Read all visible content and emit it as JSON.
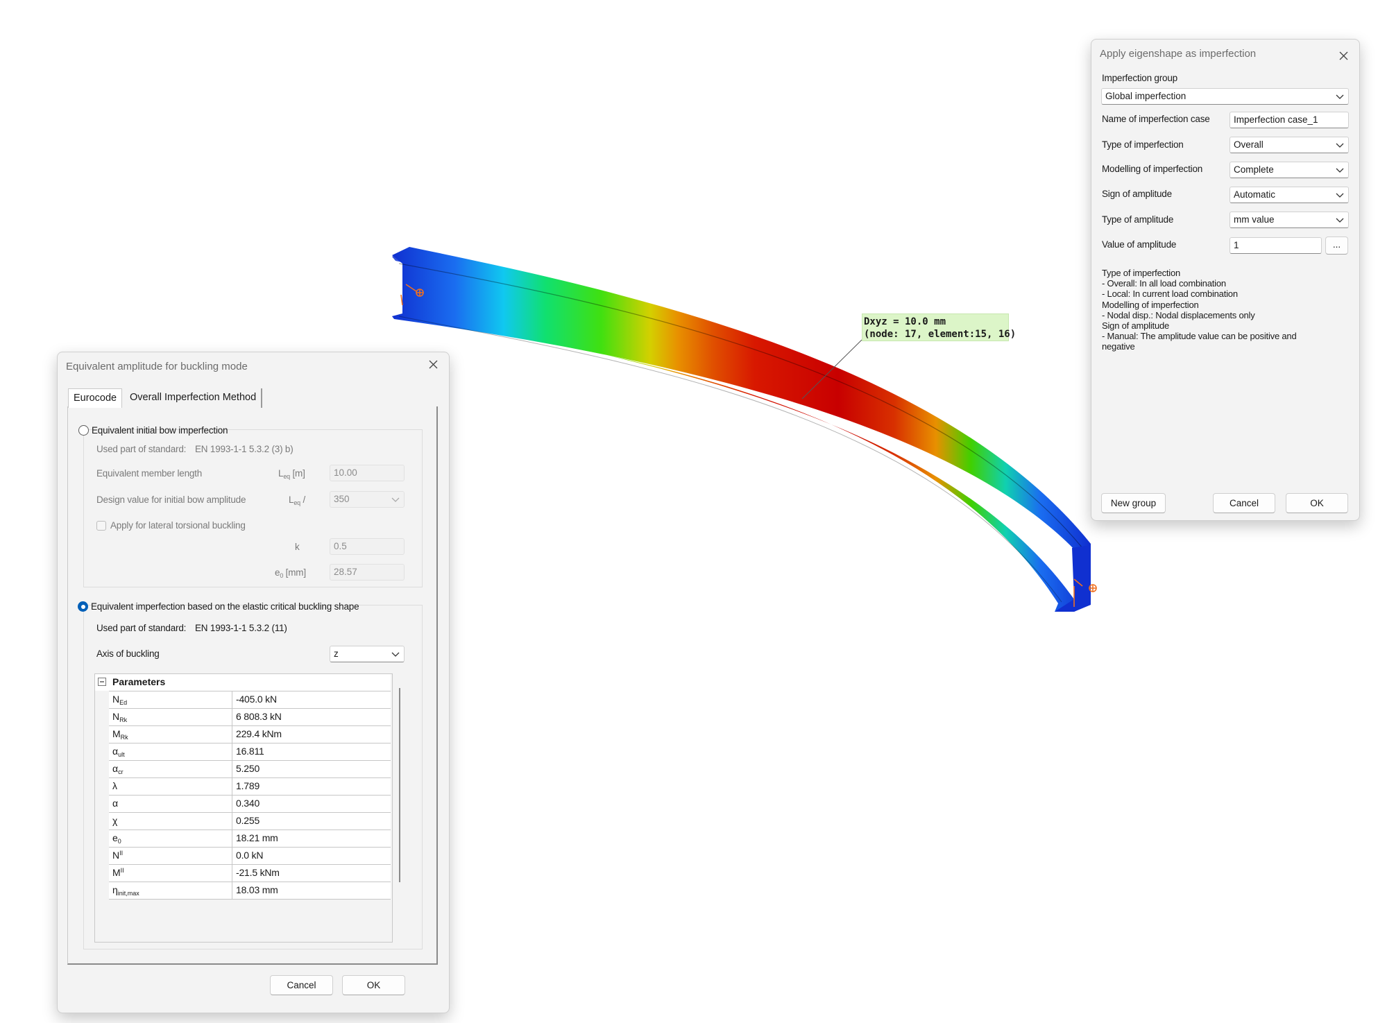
{
  "viewport": {
    "annotation_line1": "Dxyz = 10.0 mm",
    "annotation_line2": "(node: 17, element:15, 16)",
    "colors": {
      "max": "#d00000",
      "min": "#1030d0",
      "support": "#f07020"
    }
  },
  "eigen_dialog": {
    "title": "Apply eigenshape as imperfection",
    "group_label": "Imperfection group",
    "group_value": "Global imperfection",
    "fields": [
      {
        "label": "Name of imperfection case",
        "value": "Imperfection case_1",
        "kind": "text"
      },
      {
        "label": "Type of imperfection",
        "value": "Overall",
        "kind": "combo"
      },
      {
        "label": "Modelling of imperfection",
        "value": "Complete",
        "kind": "combo"
      },
      {
        "label": "Sign of amplitude",
        "value": "Automatic",
        "kind": "combo"
      },
      {
        "label": "Type of amplitude",
        "value": "mm value",
        "kind": "combo"
      },
      {
        "label": "Value of amplitude",
        "value": "1",
        "kind": "text-btn"
      }
    ],
    "browse_label": "...",
    "description": [
      "Type of imperfection",
      "- Overall: In all load combination",
      "- Local: In current load combination",
      "Modelling of imperfection",
      "- Nodal disp.: Nodal displacements only",
      "Sign of amplitude",
      "- Manual: The amplitude value can be positive and",
      "negative"
    ],
    "new_group_label": "New group",
    "cancel_label": "Cancel",
    "ok_label": "OK"
  },
  "amp_dialog": {
    "title": "Equivalent amplitude for buckling mode",
    "tabs": [
      "Eurocode",
      "Overall Imperfection Method"
    ],
    "bow": {
      "radio_label": "Equivalent initial bow imperfection",
      "standard_label": "Used part of standard:",
      "standard_value": "EN 1993-1-1 5.3.2 (3) b)",
      "length_label": "Equivalent member length",
      "length_symbol": "L",
      "length_symbol_sub": "eq",
      "length_unit": " [m]",
      "length_value": "10.00",
      "design_label": "Design value for initial bow amplitude",
      "design_symbol": "L",
      "design_symbol_sub": "eq",
      "design_suffix": " /",
      "design_value": "350",
      "lateral_label": "Apply for lateral torsional buckling",
      "k_label": "k",
      "k_value": "0.5",
      "e0_symbol": "e",
      "e0_sub": "0",
      "e0_unit": " [mm]",
      "e0_value": "28.57"
    },
    "elastic": {
      "radio_label": "Equivalent imperfection based on the elastic critical buckling shape",
      "standard_label": "Used part of standard:",
      "standard_value": "EN 1993-1-1 5.3.2 (11)",
      "axis_label": "Axis of buckling",
      "axis_value": "z"
    },
    "params_header": "Parameters",
    "params": [
      {
        "sym": "N",
        "sub": "Ed",
        "sup": "",
        "value": "-405.0 kN"
      },
      {
        "sym": "N",
        "sub": "Rk",
        "sup": "",
        "value": "6 808.3 kN"
      },
      {
        "sym": "M",
        "sub": "Rk",
        "sup": "",
        "value": "229.4 kNm"
      },
      {
        "sym": "α",
        "sub": "ult",
        "sup": "",
        "value": "16.811"
      },
      {
        "sym": "α",
        "sub": "cr",
        "sup": "",
        "value": "5.250"
      },
      {
        "sym": "λ",
        "sub": "",
        "sup": "",
        "value": "1.789"
      },
      {
        "sym": "α",
        "sub": "",
        "sup": "",
        "value": "0.340"
      },
      {
        "sym": "χ",
        "sub": "",
        "sup": "",
        "value": "0.255"
      },
      {
        "sym": "e",
        "sub": "0",
        "sup": "",
        "value": "18.21 mm"
      },
      {
        "sym": "N",
        "sub": "",
        "sup": "II",
        "value": "0.0 kN"
      },
      {
        "sym": "M",
        "sub": "",
        "sup": "II",
        "value": "-21.5 kNm"
      },
      {
        "sym": "η",
        "sub": "init,max",
        "sup": "",
        "value": "18.03 mm"
      }
    ],
    "cancel_label": "Cancel",
    "ok_label": "OK"
  }
}
